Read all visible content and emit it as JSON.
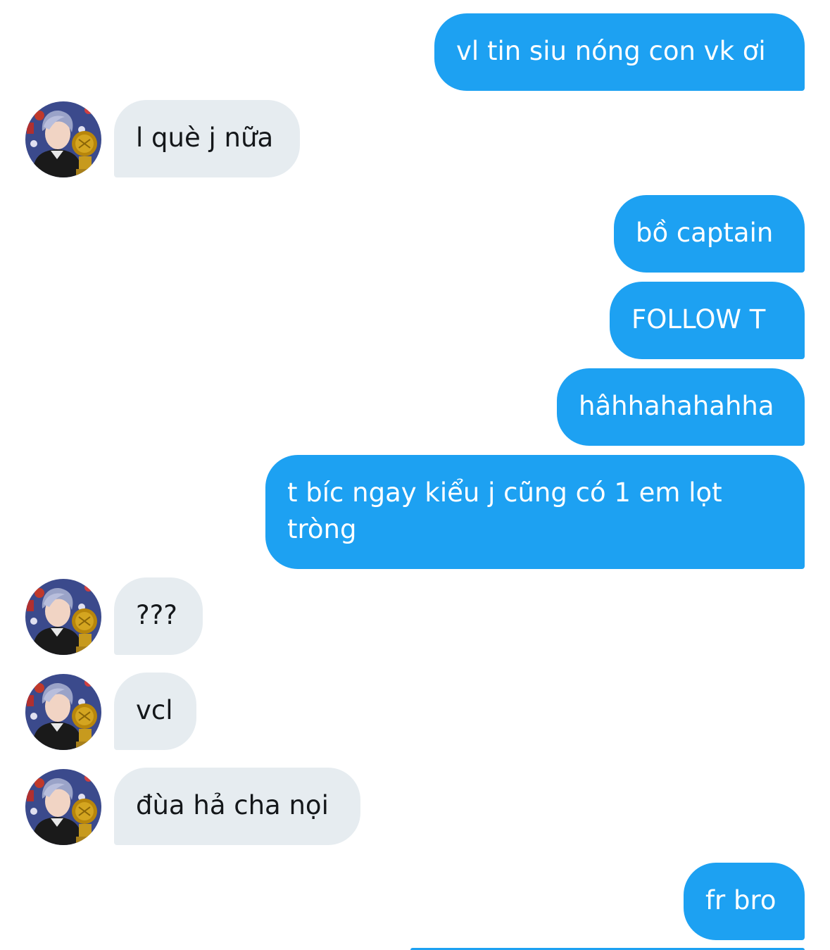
{
  "conversation": {
    "messages": [
      {
        "sender": "me",
        "text": "vl tin siu nóng con vk ơi"
      },
      {
        "sender": "them",
        "text": "l què j nữa"
      },
      {
        "sender": "me",
        "text": "bồ captain"
      },
      {
        "sender": "me",
        "text": "FOLLOW T"
      },
      {
        "sender": "me",
        "text": "hâhhahahahha"
      },
      {
        "sender": "me",
        "text": "t bíc ngay kiểu j cũng có 1 em lọt tròng"
      },
      {
        "sender": "them",
        "text": "???"
      },
      {
        "sender": "them",
        "text": "vcl"
      },
      {
        "sender": "them",
        "text": "đùa hả cha nọi"
      },
      {
        "sender": "me",
        "text": "fr bro"
      }
    ]
  },
  "colors": {
    "sent_bubble": "#1da1f2",
    "received_bubble": "#e6ecf0",
    "sent_text": "#ffffff",
    "received_text": "#14171a"
  }
}
